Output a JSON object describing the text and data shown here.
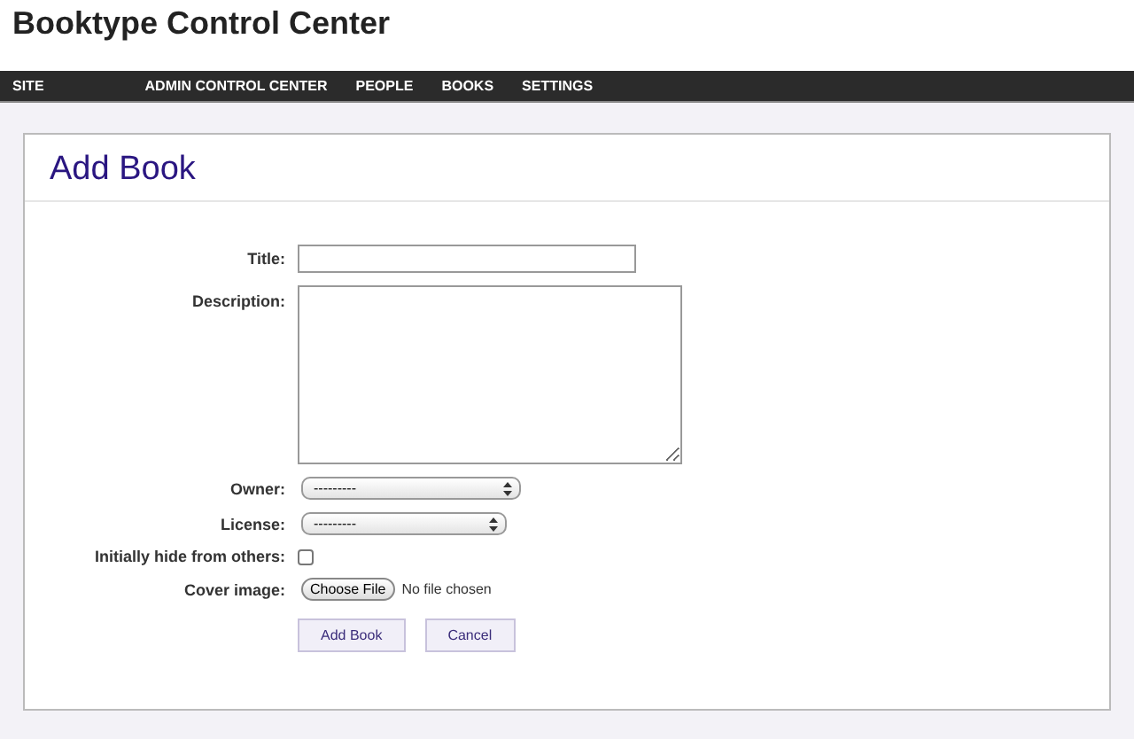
{
  "site_title": "Booktype Control Center",
  "nav": [
    {
      "label": "SITE"
    },
    {
      "label": "ADMIN CONTROL CENTER"
    },
    {
      "label": "PEOPLE"
    },
    {
      "label": "BOOKS"
    },
    {
      "label": "SETTINGS"
    }
  ],
  "panel": {
    "title": "Add Book",
    "fields": [
      {
        "kind": "text",
        "label": "Title:"
      },
      {
        "kind": "textarea",
        "label": "Description:"
      },
      {
        "kind": "select",
        "label": "Owner:",
        "value": "---------"
      },
      {
        "kind": "select",
        "label": "License:",
        "value": "---------"
      },
      {
        "kind": "checkbox",
        "label": "Initially hide from others:",
        "checked": false
      },
      {
        "kind": "file",
        "label": "Cover image:",
        "button": "Choose File",
        "status": "No file chosen"
      }
    ],
    "buttons": [
      "Add Book",
      "Cancel"
    ]
  }
}
